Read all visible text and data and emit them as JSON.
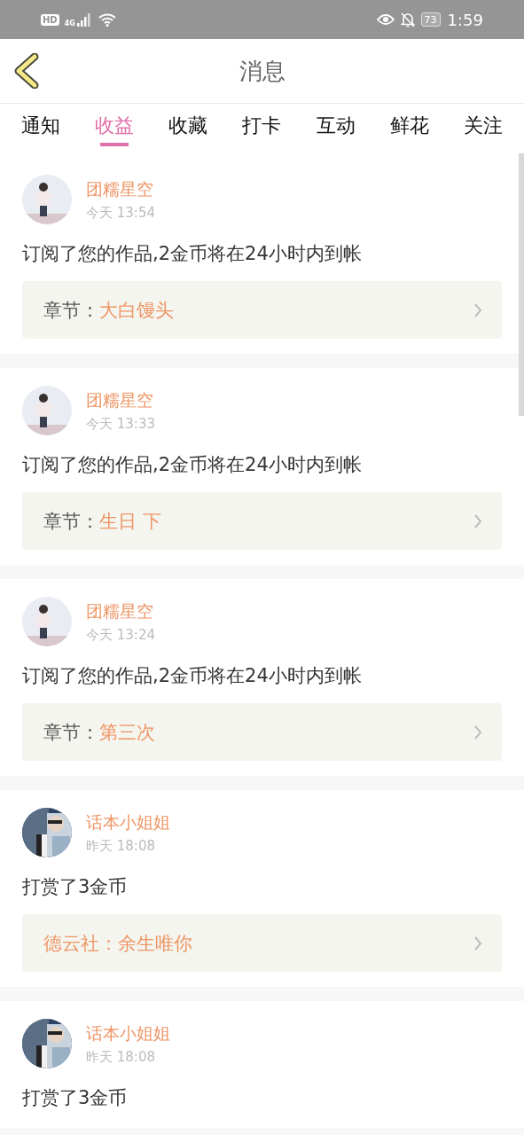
{
  "status_bar": {
    "hd": "HD",
    "network": "4G",
    "battery": "73",
    "time": "1:59"
  },
  "header": {
    "title": "消息"
  },
  "tabs": [
    {
      "label": "通知",
      "selected": false
    },
    {
      "label": "收益",
      "selected": true
    },
    {
      "label": "收藏",
      "selected": false
    },
    {
      "label": "打卡",
      "selected": false
    },
    {
      "label": "互动",
      "selected": false
    },
    {
      "label": "鲜花",
      "selected": false
    },
    {
      "label": "关注",
      "selected": false
    }
  ],
  "messages": [
    {
      "user": "团糯星空",
      "time": "今天 13:54",
      "text": "订阅了您的作品,2金币将在24小时内到帐",
      "link": {
        "label": "章节：",
        "title": "大白馒头"
      }
    },
    {
      "user": "团糯星空",
      "time": "今天 13:33",
      "text": "订阅了您的作品,2金币将在24小时内到帐",
      "link": {
        "label": "章节：",
        "title": "生日 下"
      }
    },
    {
      "user": "团糯星空",
      "time": "今天 13:24",
      "text": "订阅了您的作品,2金币将在24小时内到帐",
      "link": {
        "label": "章节：",
        "title": "第三次"
      }
    },
    {
      "user": "话本小姐姐",
      "time": "昨天 18:08",
      "text": "打赏了3金币",
      "link": {
        "title": "德云社：余生唯你"
      }
    },
    {
      "user": "话本小姐姐",
      "time": "昨天 18:08",
      "text": "打赏了3金币"
    }
  ]
}
